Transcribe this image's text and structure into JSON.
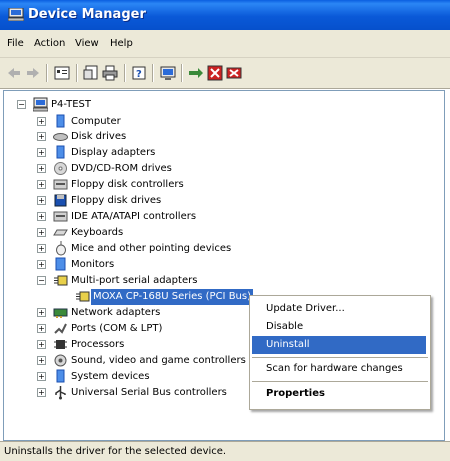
{
  "window": {
    "title": "Device Manager"
  },
  "menu": [
    "File",
    "Action",
    "View",
    "Help"
  ],
  "toolbar": {
    "buttons": [
      "back-icon",
      "forward-icon",
      "up-icon",
      "properties-icon",
      "print-icon",
      "help-icon",
      "scan-icon",
      "update-driver-icon",
      "disable-icon",
      "uninstall-icon"
    ]
  },
  "tree": {
    "root": "P4-TEST",
    "items": [
      "Computer",
      "Disk drives",
      "Display adapters",
      "DVD/CD-ROM drives",
      "Floppy disk controllers",
      "Floppy disk drives",
      "IDE ATA/ATAPI controllers",
      "Keyboards",
      "Mice and other pointing devices",
      "Monitors",
      "Multi-port serial adapters",
      "Network adapters",
      "Ports (COM & LPT)",
      "Processors",
      "Sound, video and game controllers",
      "System devices",
      "Universal Serial Bus controllers"
    ],
    "expanded_child": "MOXA CP-168U Series (PCI Bus)"
  },
  "context_menu": {
    "items": [
      "Update Driver...",
      "Disable",
      "Uninstall",
      "Scan for hardware changes",
      "Properties"
    ]
  },
  "status": "Uninstalls the driver for the selected device.",
  "colors": {
    "selection": "#316ac5",
    "title_bar": "#0a59d8",
    "chrome": "#ece9d8"
  }
}
